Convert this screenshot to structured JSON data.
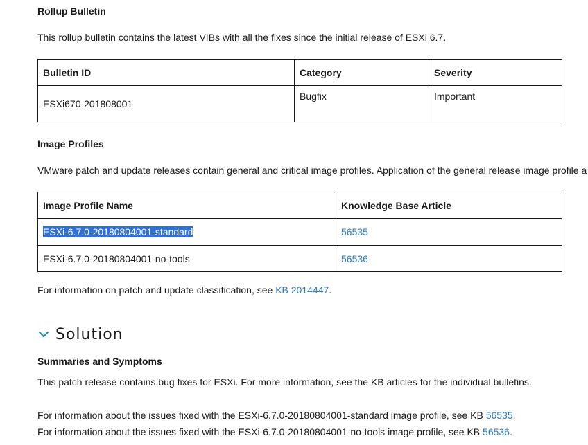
{
  "rollup": {
    "heading": "Rollup Bulletin",
    "description": "This rollup bulletin contains the latest VIBs with all the fixes since the initial release of ESXi 6.7.",
    "table": {
      "headers": [
        "Bulletin ID",
        "Category",
        "Severity"
      ],
      "rows": [
        [
          "ESXi670-201808001",
          "Bugfix",
          "Important"
        ]
      ]
    }
  },
  "image_profiles": {
    "heading": "Image Profiles",
    "description": "VMware patch and update releases contain general and critical image profiles. Application of the general release image profile a",
    "table": {
      "headers": [
        "Image Profile Name",
        "Knowledge Base Article"
      ],
      "rows": [
        {
          "name": "ESXi-6.7.0-20180804001-standard",
          "kb": "56535",
          "selected": true
        },
        {
          "name": "ESXi-6.7.0-20180804001-no-tools",
          "kb": "56536",
          "selected": false
        }
      ]
    },
    "classification_prefix": "For information on patch and update classification, see ",
    "classification_link": "KB 2014447",
    "classification_suffix": "."
  },
  "solution": {
    "title": "Solution",
    "icon": "chevron-down-icon",
    "accent_color": "#1a8fa8",
    "summaries_heading": "Summaries and Symptoms",
    "summaries_text": "This patch release contains bug fixes for ESXi. For more information, see the KB articles for the individual bulletins.",
    "info_lines": [
      {
        "prefix": "For information about the issues fixed with the ESXi-6.7.0-20180804001-standard image profile, see KB ",
        "link": "56535",
        "suffix": "."
      },
      {
        "prefix": "For information about the issues fixed with the ESXi-6.7.0-20180804001-no-tools image profile, see KB ",
        "link": "56536",
        "suffix": "."
      }
    ]
  },
  "colors": {
    "link": "#2d7bc4",
    "selection": "#2f6fd8",
    "text": "#1a1a1a"
  }
}
